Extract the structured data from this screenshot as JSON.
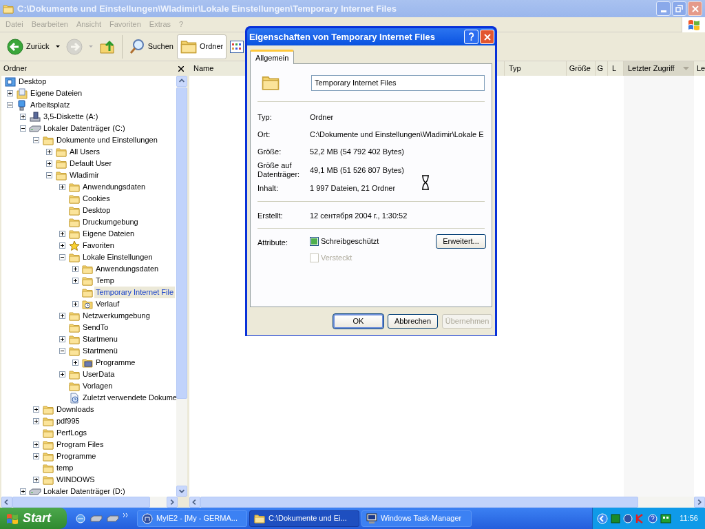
{
  "window": {
    "title": "C:\\Dokumente und Einstellungen\\Wladimir\\Lokale Einstellungen\\Temporary Internet Files"
  },
  "menu": [
    "Datei",
    "Bearbeiten",
    "Ansicht",
    "Favoriten",
    "Extras",
    "?"
  ],
  "toolbar": [
    {
      "kind": "back",
      "label": "Zurück",
      "pressed": false,
      "disabled": false
    },
    {
      "kind": "forward",
      "pressed": false,
      "disabled": true
    },
    {
      "kind": "up",
      "pressed": false,
      "disabled": false
    },
    {
      "kind": "search",
      "label": "Suchen",
      "pressed": false,
      "disabled": false
    },
    {
      "kind": "folders",
      "label": "Ordner",
      "pressed": true,
      "disabled": false
    },
    {
      "kind": "views",
      "pressed": false,
      "disabled": false
    }
  ],
  "folder_pane": {
    "title": "Ordner"
  },
  "tree": [
    {
      "label": "Desktop",
      "kind": "desktop",
      "selected": false,
      "children": [
        {
          "label": "Eigene Dateien",
          "kind": "documents",
          "expanded": false,
          "selected": false
        },
        {
          "label": "Arbeitsplatz",
          "kind": "computer",
          "expanded": true,
          "selected": false,
          "children": [
            {
              "label": "3,5-Diskette (A:)",
              "kind": "floppy",
              "expanded": false,
              "selected": false
            },
            {
              "label": "Lokaler Datenträger (C:)",
              "kind": "drive",
              "expanded": true,
              "selected": false,
              "children": [
                {
                  "label": "Dokumente und Einstellungen",
                  "kind": "folder",
                  "expanded": true,
                  "selected": false,
                  "children": [
                    {
                      "label": "All Users",
                      "kind": "folder",
                      "expanded": false,
                      "selected": false
                    },
                    {
                      "label": "Default User",
                      "kind": "folder",
                      "expanded": false,
                      "selected": false
                    },
                    {
                      "label": "Wladimir",
                      "kind": "folder",
                      "expanded": true,
                      "selected": false,
                      "children": [
                        {
                          "label": "Anwendungsdaten",
                          "kind": "folder",
                          "expanded": false,
                          "selected": false
                        },
                        {
                          "label": "Cookies",
                          "kind": "folder",
                          "selected": false
                        },
                        {
                          "label": "Desktop",
                          "kind": "folder",
                          "selected": false
                        },
                        {
                          "label": "Druckumgebung",
                          "kind": "folder",
                          "selected": false
                        },
                        {
                          "label": "Eigene Dateien",
                          "kind": "folder",
                          "expanded": false,
                          "selected": false
                        },
                        {
                          "label": "Favoriten",
                          "kind": "star",
                          "expanded": false,
                          "selected": false
                        },
                        {
                          "label": "Lokale Einstellungen",
                          "kind": "folder",
                          "expanded": true,
                          "selected": false,
                          "children": [
                            {
                              "label": "Anwendungsdaten",
                              "kind": "folder",
                              "expanded": false,
                              "selected": false
                            },
                            {
                              "label": "Temp",
                              "kind": "folder",
                              "expanded": false,
                              "selected": false
                            },
                            {
                              "label": "Temporary Internet File",
                              "kind": "folder",
                              "selected": true
                            },
                            {
                              "label": "Verlauf",
                              "kind": "history",
                              "expanded": false,
                              "selected": false
                            }
                          ]
                        },
                        {
                          "label": "Netzwerkumgebung",
                          "kind": "folder",
                          "expanded": false,
                          "selected": false
                        },
                        {
                          "label": "SendTo",
                          "kind": "folder",
                          "selected": false
                        },
                        {
                          "label": "Startmenu",
                          "kind": "folder",
                          "expanded": false,
                          "selected": false
                        },
                        {
                          "label": "Startmenü",
                          "kind": "folder",
                          "expanded": true,
                          "selected": false,
                          "children": [
                            {
                              "label": "Programme",
                              "kind": "programs",
                              "expanded": false,
                              "selected": false
                            }
                          ]
                        },
                        {
                          "label": "UserData",
                          "kind": "folder",
                          "expanded": false,
                          "selected": false
                        },
                        {
                          "label": "Vorlagen",
                          "kind": "folder",
                          "selected": false
                        },
                        {
                          "label": "Zuletzt verwendete Dokume",
                          "kind": "recent",
                          "selected": false
                        }
                      ]
                    }
                  ]
                },
                {
                  "label": "Downloads",
                  "kind": "folder",
                  "expanded": false,
                  "selected": false
                },
                {
                  "label": "pdf995",
                  "kind": "folder",
                  "expanded": false,
                  "selected": false
                },
                {
                  "label": "PerfLogs",
                  "kind": "folder",
                  "selected": false
                },
                {
                  "label": "Program Files",
                  "kind": "folder",
                  "expanded": false,
                  "selected": false
                },
                {
                  "label": "Programme",
                  "kind": "folder",
                  "expanded": false,
                  "selected": false
                },
                {
                  "label": "temp",
                  "kind": "folder",
                  "selected": false
                },
                {
                  "label": "WINDOWS",
                  "kind": "folder",
                  "expanded": false,
                  "selected": false
                }
              ]
            },
            {
              "label": "Lokaler Datenträger (D:)",
              "kind": "drive",
              "expanded": false,
              "selected": false
            }
          ]
        }
      ]
    }
  ],
  "columns": [
    {
      "label": "Name",
      "sorted": false
    },
    {
      "label": "Typ",
      "sorted": false
    },
    {
      "label": "Größe",
      "sorted": false
    },
    {
      "label": "G",
      "sorted": false
    },
    {
      "label": "L",
      "sorted": false
    },
    {
      "label": "Letzter Zugriff",
      "sorted": true
    },
    {
      "label": "Le",
      "sorted": false
    }
  ],
  "dialog": {
    "title": "Eigenschaften von Temporary Internet Files",
    "tabs": [
      {
        "label": "Allgemein",
        "selected": true
      }
    ],
    "name": "Temporary Internet Files",
    "properties": [
      {
        "label": "Typ:",
        "value": "Ordner"
      },
      {
        "label": "Ort:",
        "value": "C:\\Dokumente und Einstellungen\\Wladimir\\Lokale E"
      },
      {
        "label": "Größe:",
        "value": "52,2 MB (54 792 402 Bytes)"
      },
      {
        "label": "Größe auf Datenträger:",
        "value": "49,1 MB (51 526 807 Bytes)"
      },
      {
        "label": "Inhalt:",
        "value": "1 997 Dateien, 21 Ordner"
      }
    ],
    "created": {
      "label": "Erstellt:",
      "value": "12 сентября 2004 г., 1:30:52"
    },
    "attributes": {
      "label": "Attribute:",
      "options": [
        {
          "label": "Schreibgeschützt",
          "checked": false,
          "mixed": true,
          "disabled": false
        },
        {
          "label": "Versteckt",
          "checked": false,
          "mixed": false,
          "disabled": true
        }
      ],
      "advanced": "Erweitert..."
    },
    "buttons": [
      {
        "label": "OK",
        "default": true,
        "disabled": false
      },
      {
        "label": "Abbrechen",
        "default": false,
        "disabled": false
      },
      {
        "label": "Übernehmen",
        "default": false,
        "disabled": true
      }
    ]
  },
  "taskbar": {
    "start": "Start",
    "tasks": [
      {
        "label": "MyIE2 - [My - GERMA...",
        "kind": "browser",
        "selected": false
      },
      {
        "label": "C:\\Dokumente und Ei...",
        "kind": "folder",
        "selected": true
      },
      {
        "label": "Windows Task-Manager",
        "kind": "monitor",
        "selected": false
      }
    ],
    "clock": "11:56"
  }
}
